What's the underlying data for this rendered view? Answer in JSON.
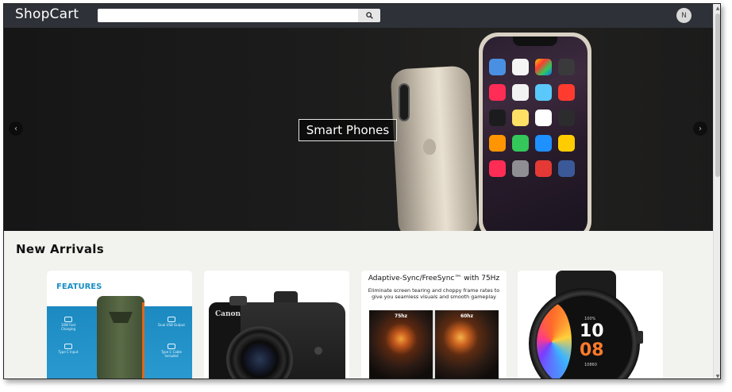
{
  "app": {
    "brand": "ShopCart"
  },
  "header": {
    "search": {
      "value": "",
      "placeholder": ""
    },
    "search_button_icon": "search-icon",
    "avatar_initial": "N"
  },
  "hero": {
    "caption": "Smart Phones",
    "prev_icon": "chevron-left-icon",
    "next_icon": "chevron-right-icon",
    "prev_glyph": "‹",
    "next_glyph": "›"
  },
  "new_arrivals": {
    "title": "New Arrivals",
    "products": [
      {
        "image": "power-bank",
        "features_title": "FEATURES",
        "features": [
          "10W Fast Charging",
          "Dual USB Output",
          "Type C Input",
          "Type C Cable Included"
        ]
      },
      {
        "image": "canon-camera",
        "brand_text": "Canon"
      },
      {
        "image": "monitor-adaptive-sync",
        "title": "Adaptive-Sync/FreeSync™ with 75Hz",
        "subtitle": "Eliminate screen tearing and choppy frame rates to give you seamless visuals and smooth gameplay",
        "left_label": "75hz",
        "right_label": "60hz"
      },
      {
        "image": "smartwatch",
        "battery": "100%",
        "hours": "10",
        "minutes": "08",
        "steps": "10860"
      }
    ]
  },
  "scrollbar": {
    "up_glyph": "▲",
    "down_glyph": "▼"
  },
  "colors": {
    "navbar": "#2e3138",
    "page_background": "#f2f2ee",
    "features_blue": "#1a8fc4",
    "watch_accent": "#ff7a2a"
  }
}
